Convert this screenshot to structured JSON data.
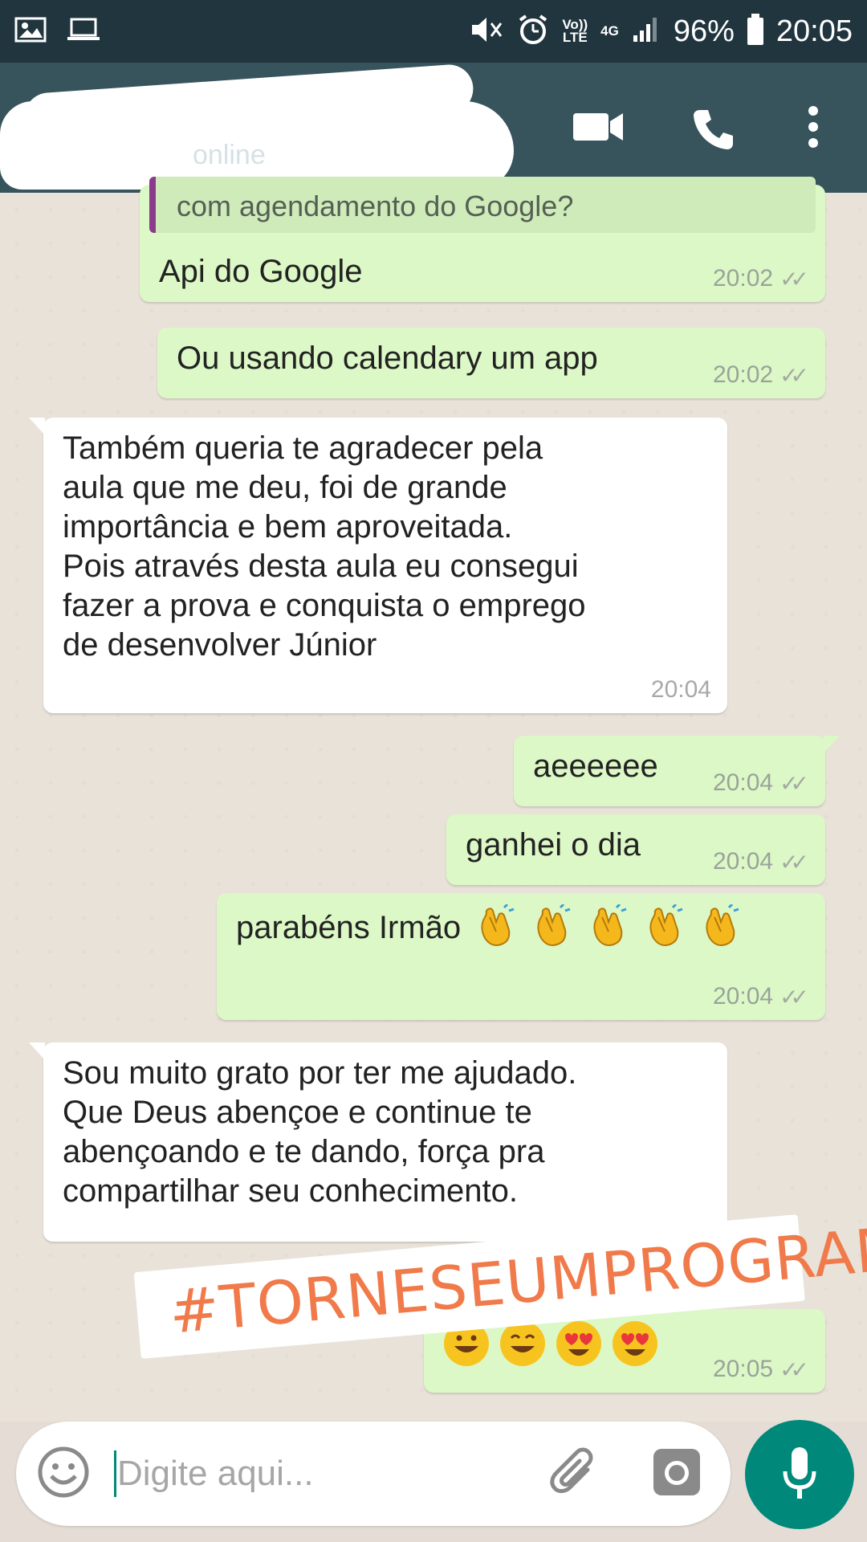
{
  "status_bar": {
    "battery": "96%",
    "time": "20:05",
    "network_4g": "4G",
    "volte_top": "Vo))",
    "volte_bottom": "LTE"
  },
  "header": {
    "contact_status": "online"
  },
  "messages": [
    {
      "dir": "out",
      "quote": "com agendamento do Google?",
      "text": "Api do Google",
      "time": "20:02",
      "ticks": "✓✓"
    },
    {
      "dir": "out",
      "text": "Ou usando calendary um app",
      "time": "20:02",
      "ticks": "✓✓"
    },
    {
      "dir": "in",
      "text": "Também queria te agradecer pela\naula que me deu, foi de grande\nimportância e bem aproveitada.\nPois através desta aula eu consegui\nfazer a prova e conquista o emprego\nde desenvolver Júnior",
      "time": "20:04"
    },
    {
      "dir": "out",
      "text": "aeeeeee",
      "time": "20:04",
      "ticks": "✓✓"
    },
    {
      "dir": "out",
      "text": "ganhei o dia",
      "time": "20:04",
      "ticks": "✓✓"
    },
    {
      "dir": "out",
      "text": "parabéns Irmão",
      "time": "20:04",
      "ticks": "✓✓",
      "emoji_count": 5
    },
    {
      "dir": "in",
      "text": "Sou muito grato por ter me ajudado.\nQue Deus abençoe e continue te\nabençoando e te dando, força pra\ncompartilhar seu conhecimento."
    },
    {
      "dir": "out",
      "time": "20:05",
      "ticks": "✓✓"
    }
  ],
  "sticker": {
    "text": "#TORNESEUMPROGRAMADOR"
  },
  "input": {
    "placeholder": "Digite aqui..."
  },
  "colors": {
    "status_bar": "#21353f",
    "header": "#37535c",
    "outgoing_bubble": "#dcf8c6",
    "incoming_bubble": "#ffffff",
    "accent": "#00897b",
    "sticker_text": "#f07a4a"
  },
  "icons": [
    "image-icon",
    "laptop-icon",
    "mute-icon",
    "alarm-icon",
    "signal-icon",
    "battery-icon",
    "video-call-icon",
    "phone-icon",
    "more-icon",
    "emoji-icon",
    "attach-icon",
    "camera-icon",
    "mic-icon",
    "clap-emoji",
    "grin-emoji",
    "heart-eyes-emoji"
  ]
}
